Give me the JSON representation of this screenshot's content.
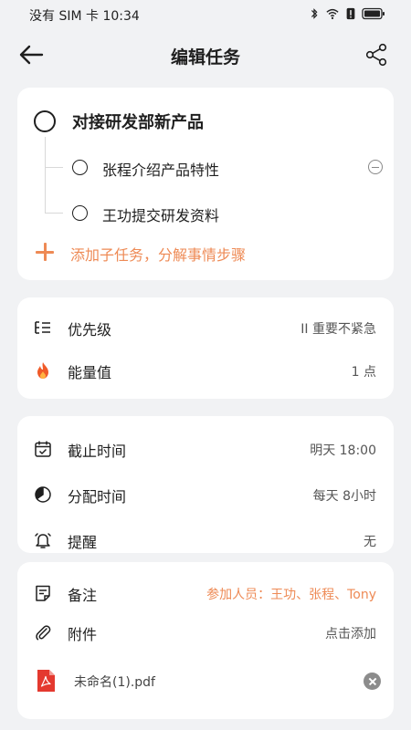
{
  "status_bar": {
    "carrier": "没有 SIM 卡",
    "time": "10:34",
    "icons": [
      "bluetooth-icon",
      "wifi-icon",
      "alert-icon",
      "battery-icon"
    ]
  },
  "header": {
    "title": "编辑任务",
    "back_icon": "arrow-left-icon",
    "share_icon": "share-icon"
  },
  "task": {
    "title": "对接研发部新产品",
    "subtasks": [
      {
        "label": "张程介绍产品特性"
      },
      {
        "label": "王功提交研发资料"
      }
    ],
    "add_subtask_label": "添加子任务，分解事情步骤"
  },
  "priority_section": {
    "rows": [
      {
        "icon": "priority-list-icon",
        "label": "优先级",
        "value": "II 重要不紧急"
      },
      {
        "icon": "fire-icon",
        "label": "能量值",
        "value": "1 点"
      }
    ]
  },
  "time_section": {
    "rows": [
      {
        "icon": "calendar-icon",
        "label": "截止时间",
        "value": "明天 18:00"
      },
      {
        "icon": "pie-clock-icon",
        "label": "分配时间",
        "value": "每天 8小时"
      },
      {
        "icon": "bell-icon",
        "label": "提醒",
        "value": "无"
      }
    ]
  },
  "notes_section": {
    "rows": [
      {
        "icon": "note-icon",
        "label": "备注",
        "value": "参加人员：王功、张程、Tony"
      },
      {
        "icon": "paperclip-icon",
        "label": "附件",
        "value": "点击添加"
      }
    ],
    "attachment": {
      "icon": "pdf-file-icon",
      "name": "未命名(1).pdf"
    }
  },
  "colors": {
    "accent": "#ee8a55",
    "background": "#f1f2f4",
    "card": "#ffffff",
    "fire": "#f05a28"
  }
}
